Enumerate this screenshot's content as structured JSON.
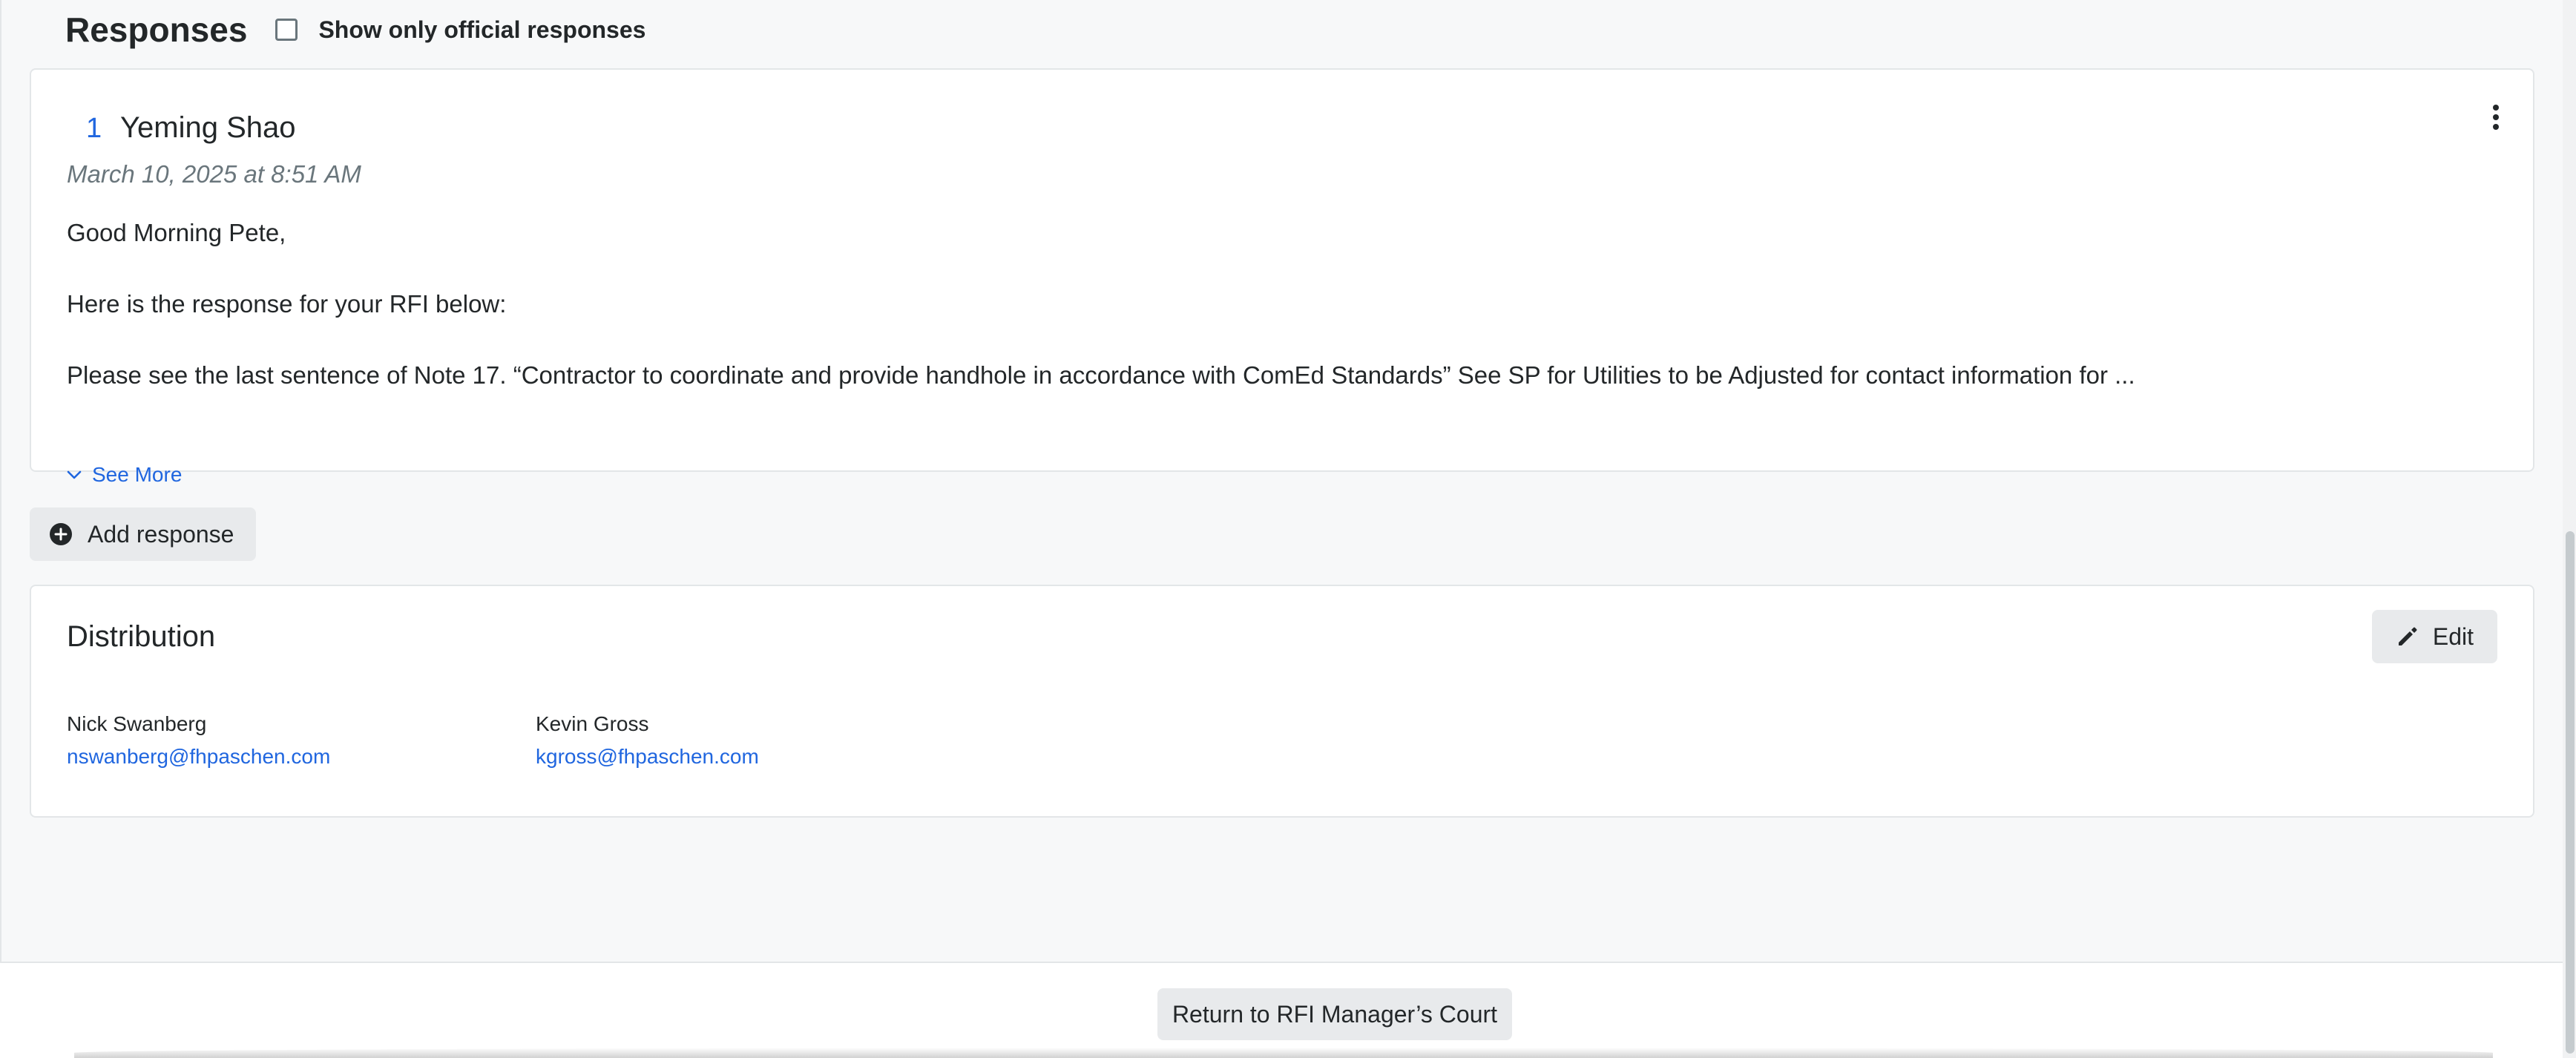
{
  "responses": {
    "title": "Responses",
    "official_filter_label": "Show only official responses",
    "items": [
      {
        "number": "1",
        "author": "Yeming Shao",
        "date": "March 10, 2025 at 8:51 AM",
        "paragraphs": [
          "Good Morning Pete,",
          "Here is the response for your RFI below:",
          "Please see the last sentence of Note 17. “Contractor to coordinate and provide handhole in accordance with ComEd Standards”  See SP for Utilities to be Adjusted for contact information for ..."
        ],
        "see_more_label": "See More"
      }
    ],
    "add_response_label": "Add response"
  },
  "distribution": {
    "title": "Distribution",
    "edit_label": "Edit",
    "recipients": [
      {
        "name": "Nick Swanberg",
        "email": "nswanberg@fhpaschen.com"
      },
      {
        "name": "Kevin Gross",
        "email": "kgross@fhpaschen.com"
      }
    ]
  },
  "footer": {
    "return_button_label": "Return to RFI Manager’s Court"
  },
  "colors": {
    "accent": "#2066df",
    "text": "#232729",
    "muted": "#6a767c",
    "button_bg": "#e8eaec",
    "page_bg": "#f7f8f9"
  }
}
